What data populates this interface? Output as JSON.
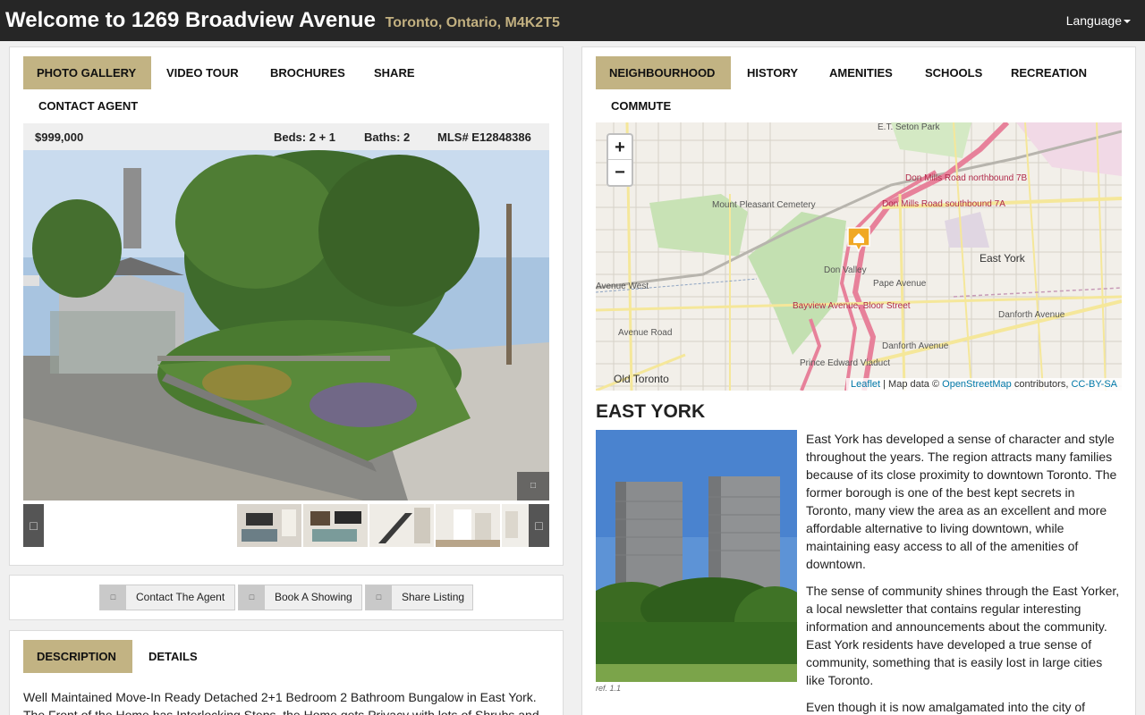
{
  "header": {
    "title": "Welcome to 1269 Broadview Avenue",
    "subtitle": "Toronto, Ontario, M4K2T5",
    "language_label": "Language"
  },
  "gallery": {
    "tabs": [
      "PHOTO GALLERY",
      "VIDEO TOUR",
      "BROCHURES",
      "SHARE",
      "CONTACT AGENT"
    ],
    "price": "$999,000",
    "beds": "Beds: 2 + 1",
    "baths": "Baths: 2",
    "mls": "MLS# E12848386",
    "icons": {
      "expand": "expand-icon",
      "prev": "chevron-left-icon",
      "next": "chevron-right-icon"
    }
  },
  "actions": {
    "contact": "Contact The Agent",
    "showing": "Book A Showing",
    "share": "Share Listing"
  },
  "description": {
    "tabs": [
      "DESCRIPTION",
      "DETAILS"
    ],
    "text": "Well Maintained Move-In Ready Detached 2+1 Bedroom 2 Bathroom Bungalow in East York. The Front of the Home has Interlocking Steps, the Home gets Privacy with lots of Shrubs and"
  },
  "neighbourhood": {
    "tabs": [
      "NEIGHBOURHOOD",
      "HISTORY",
      "AMENITIES",
      "SCHOOLS",
      "RECREATION",
      "COMMUTE"
    ],
    "map": {
      "zoom_in": "+",
      "zoom_out": "−",
      "labels": {
        "seton_park": "E.T. Seton Park",
        "cemetery": "Mount Pleasant Cemetery",
        "don_mills_north": "Don Mills Road northbound 7B",
        "don_mills_south": "Don Mills Road southbound 7A",
        "east_york": "East York",
        "bayview": "Bayview Avenue, Bloor Street",
        "prince_edward": "Prince Edward Viaduct",
        "old_toronto": "Old Toronto",
        "pape": "Pape Avenue",
        "danforth1": "Danforth Avenue",
        "danforth2": "Danforth Avenue",
        "don_valley": "Don Valley",
        "avenue_road": "Avenue Road",
        "avenue_west": "Avenue West"
      },
      "attrib_leaflet": "Leaflet",
      "attrib_mid": " | Map data © ",
      "attrib_osm": "OpenStreetMap",
      "attrib_contrib": " contributors, ",
      "attrib_license": "CC-BY-SA"
    },
    "region_title": "EAST YORK",
    "image_ref": "ref. 1.1",
    "paragraphs": [
      "East York has developed a sense of character and style throughout the years. The region attracts many families because of its close proximity to downtown Toronto. The former borough is one of the best kept secrets in Toronto, many view the area as an excellent and more affordable alternative to living downtown, while maintaining easy access to all of the amenities of downtown.",
      "The sense of community shines through the East Yorker, a local newsletter that contains regular interesting information and announcements about the community. East York residents have developed a true sense of community, something that is easily lost in large cities like Toronto.",
      "Even though it is now amalgamated into the city of"
    ]
  }
}
